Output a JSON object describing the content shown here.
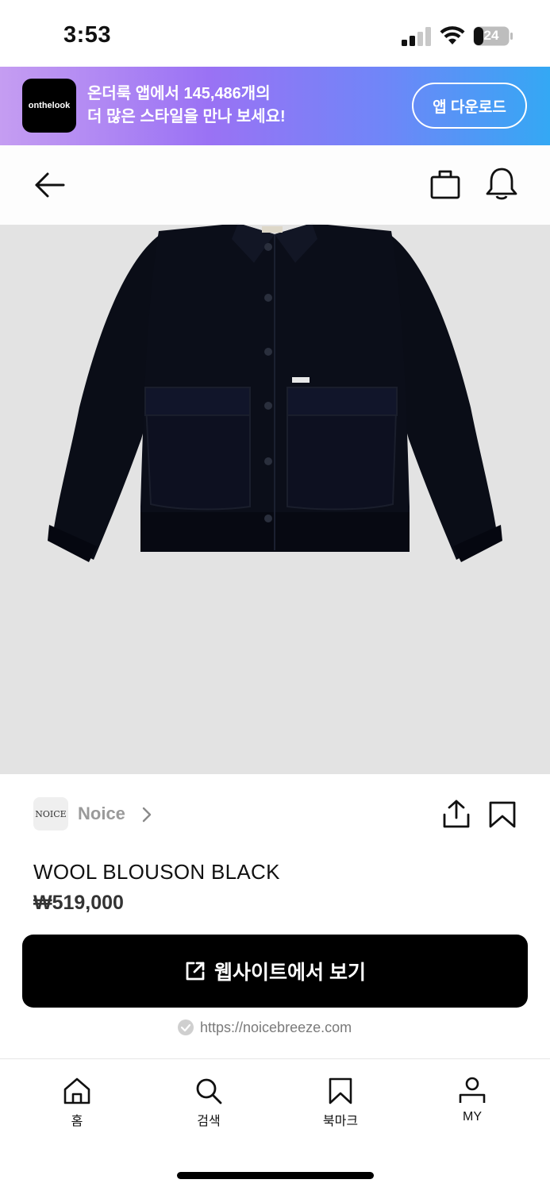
{
  "status_bar": {
    "time": "3:53",
    "battery": "24"
  },
  "promo": {
    "logo_text": "onthelook",
    "line1": "온더룩 앱에서 145,486개의",
    "line2": "더 많은 스타일을 만나 보세요!",
    "button": "앱 다운로드"
  },
  "brand": {
    "logo_text": "NOICE",
    "name": "Noice"
  },
  "product": {
    "title": "WOOL BLOUSON BLACK",
    "price": "₩519,000"
  },
  "cta": {
    "label": "웹사이트에서 보기"
  },
  "site": {
    "url": "https://noicebreeze.com"
  },
  "tabs": [
    {
      "label": "홈",
      "icon": "home-icon"
    },
    {
      "label": "검색",
      "icon": "search-icon"
    },
    {
      "label": "북마크",
      "icon": "bookmark-icon"
    },
    {
      "label": "MY",
      "icon": "user-icon"
    }
  ],
  "colors": {
    "promo_gradient_start": "#c59df2",
    "promo_gradient_end": "#34a8f4",
    "cta_background": "#000000",
    "image_background": "#e3e3e3"
  }
}
